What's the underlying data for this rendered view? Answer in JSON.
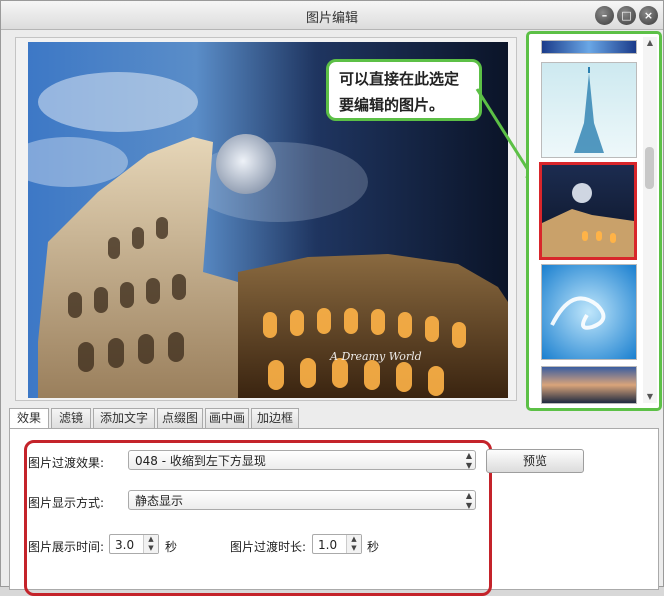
{
  "window": {
    "title": "图片编辑",
    "controls": [
      "minimize",
      "maximize",
      "close"
    ]
  },
  "preview": {
    "watermark": "A Dreamy World"
  },
  "callout": {
    "line1": "可以直接在此选定",
    "line2": "要编辑的图片。"
  },
  "tabs": [
    {
      "label": "效果",
      "active": true
    },
    {
      "label": "滤镜",
      "active": false
    },
    {
      "label": "添加文字",
      "active": false
    },
    {
      "label": "点缀图",
      "active": false
    },
    {
      "label": "画中画",
      "active": false
    },
    {
      "label": "加边框",
      "active": false
    }
  ],
  "effects": {
    "transition_label": "图片过渡效果:",
    "transition_value": "048 - 收缩到左下方显现",
    "display_mode_label": "图片显示方式:",
    "display_mode_value": "静态显示",
    "show_time_label": "图片展示时间:",
    "show_time_value": "3.0",
    "show_time_unit": "秒",
    "transition_time_label": "图片过渡时长:",
    "transition_time_value": "1.0",
    "transition_time_unit": "秒",
    "preview_button": "预览"
  },
  "colors": {
    "highlight_green": "#5cc046",
    "selection_red": "#d8262b"
  }
}
